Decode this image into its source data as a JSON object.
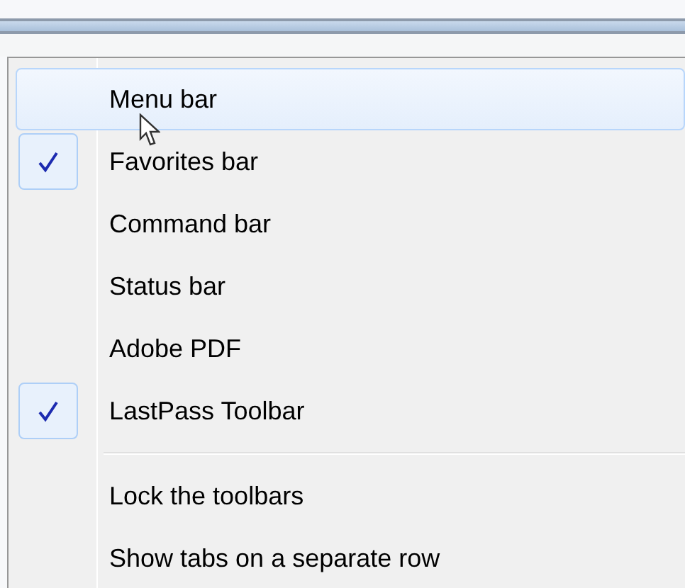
{
  "menu": {
    "items": [
      {
        "kind": "item",
        "label": "Menu bar",
        "checked": false,
        "selected": true
      },
      {
        "kind": "item",
        "label": "Favorites bar",
        "checked": true,
        "selected": false
      },
      {
        "kind": "item",
        "label": "Command bar",
        "checked": false,
        "selected": false
      },
      {
        "kind": "item",
        "label": "Status bar",
        "checked": false,
        "selected": false
      },
      {
        "kind": "item",
        "label": "Adobe PDF",
        "checked": false,
        "selected": false
      },
      {
        "kind": "item",
        "label": "LastPass Toolbar",
        "checked": true,
        "selected": false
      },
      {
        "kind": "separator"
      },
      {
        "kind": "item",
        "label": "Lock the toolbars",
        "checked": false,
        "selected": false
      },
      {
        "kind": "item",
        "label": "Show tabs on a separate row",
        "checked": false,
        "selected": false
      }
    ]
  }
}
